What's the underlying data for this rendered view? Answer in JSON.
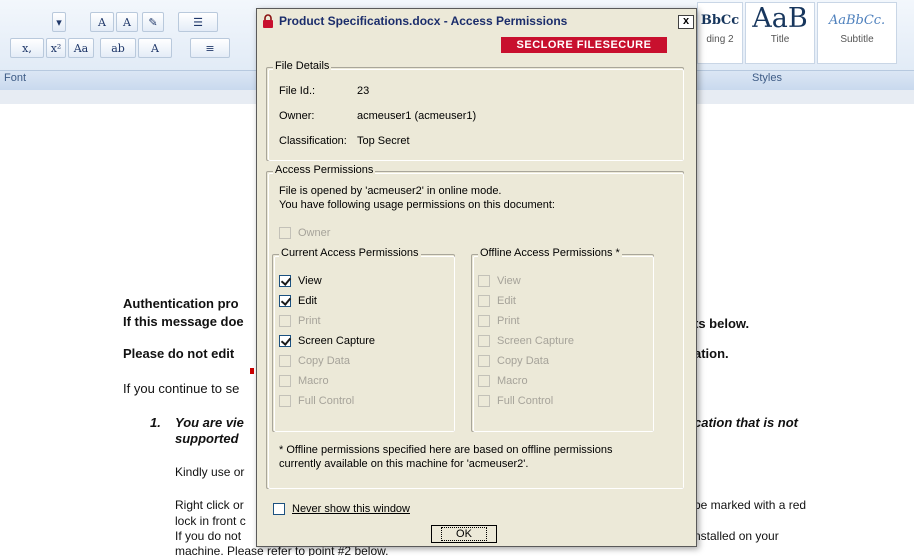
{
  "ribbon": {
    "font_group_label": "Font",
    "styles_group_label": "Styles",
    "buttons": [
      "A",
      "A",
      "Aa",
      "A"
    ],
    "style_samples": [
      {
        "sample": "BbCc",
        "name": "ding 2"
      },
      {
        "sample": "AaB",
        "name": "Title"
      },
      {
        "sample": "AaBbCc.",
        "name": "Subtitle"
      }
    ]
  },
  "document": {
    "line1": "Authentication pro",
    "line1_right": "ts below.",
    "line2": "If this message doe",
    "line3": "Please do not edit",
    "line3_right": "ation.",
    "line4": "If you continue to se",
    "item1_num": "1.",
    "item1_a": "You are vie",
    "item1_a_right": "cation that is not",
    "item1_b": "supported",
    "line5": "Kindly use or",
    "line6": "Right click or",
    "line6_right": "be marked with a red",
    "line7": "lock in front c",
    "line8": "If you do not",
    "line8_right": "nstalled on your",
    "line9": "machine. Please refer to point #2 below."
  },
  "dialog": {
    "title": "Product Specifications.docx - Access Permissions",
    "close_label": "x",
    "brand_a": "SECLORE",
    "brand_b": "FILESECURE",
    "file_details": {
      "legend": "File Details",
      "file_id_label": "File Id.:",
      "file_id": "23",
      "owner_label": "Owner:",
      "owner": "acmeuser1 (acmeuser1)",
      "classification_label": "Classification:",
      "classification": "Top Secret"
    },
    "access": {
      "legend": "Access Permissions",
      "line1": "File is opened by 'acmeuser2' in online mode.",
      "line2": "You have following usage permissions on this document:",
      "owner_label": "Owner"
    },
    "current": {
      "legend": "Current Access Permissions",
      "items": [
        {
          "label": "View",
          "checked": true,
          "enabled": true
        },
        {
          "label": "Edit",
          "checked": true,
          "enabled": true
        },
        {
          "label": "Print",
          "checked": false,
          "enabled": false
        },
        {
          "label": "Screen Capture",
          "checked": true,
          "enabled": true
        },
        {
          "label": "Copy Data",
          "checked": false,
          "enabled": false
        },
        {
          "label": "Macro",
          "checked": false,
          "enabled": false
        },
        {
          "label": "Full Control",
          "checked": false,
          "enabled": false
        }
      ]
    },
    "offline": {
      "legend": "Offline  Access Permissions *",
      "items": [
        {
          "label": "View"
        },
        {
          "label": "Edit"
        },
        {
          "label": "Print"
        },
        {
          "label": "Screen Capture"
        },
        {
          "label": "Copy Data"
        },
        {
          "label": "Macro"
        },
        {
          "label": "Full Control"
        }
      ]
    },
    "footnote1": "* Offline permissions specified here are based on offline permissions",
    "footnote2": "currently available on this machine for 'acmeuser2'.",
    "never_show_label": "Never show this window",
    "ok_label": "OK"
  },
  "colors": {
    "dialog_bg": "#ece9d8",
    "brand_red": "#c8102e",
    "title_text": "#1b2d6b"
  }
}
